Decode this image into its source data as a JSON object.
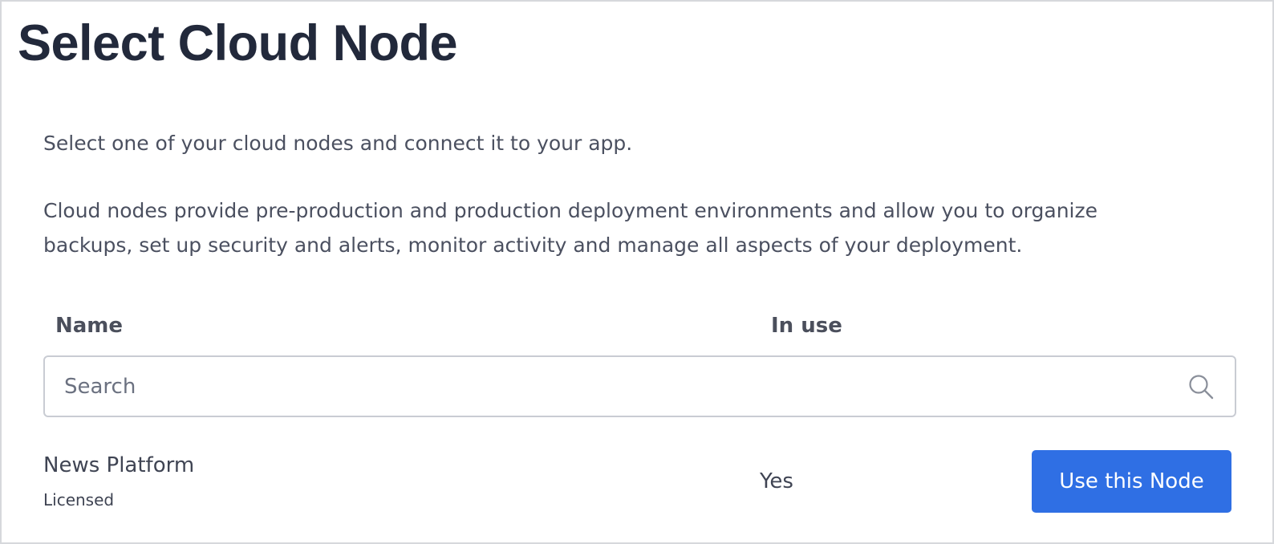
{
  "page": {
    "title": "Select Cloud Node",
    "intro": "Select one of your cloud nodes and connect it to your app.",
    "description": "Cloud nodes provide pre-production and production deployment environments and allow you to organize backups, set up security and alerts, monitor activity and manage all aspects of your deployment."
  },
  "table": {
    "columns": [
      "Name",
      "In use"
    ],
    "search": {
      "placeholder": "Search",
      "value": "",
      "icon": "search-icon"
    },
    "rows": [
      {
        "name": "News Platform",
        "license": "Licensed",
        "in_use": "Yes",
        "action_label": "Use this Node"
      }
    ]
  },
  "colors": {
    "title": "#22293b",
    "text": "#4b5060",
    "primary_button": "#2f6fe4",
    "border": "#c9ccd3"
  }
}
